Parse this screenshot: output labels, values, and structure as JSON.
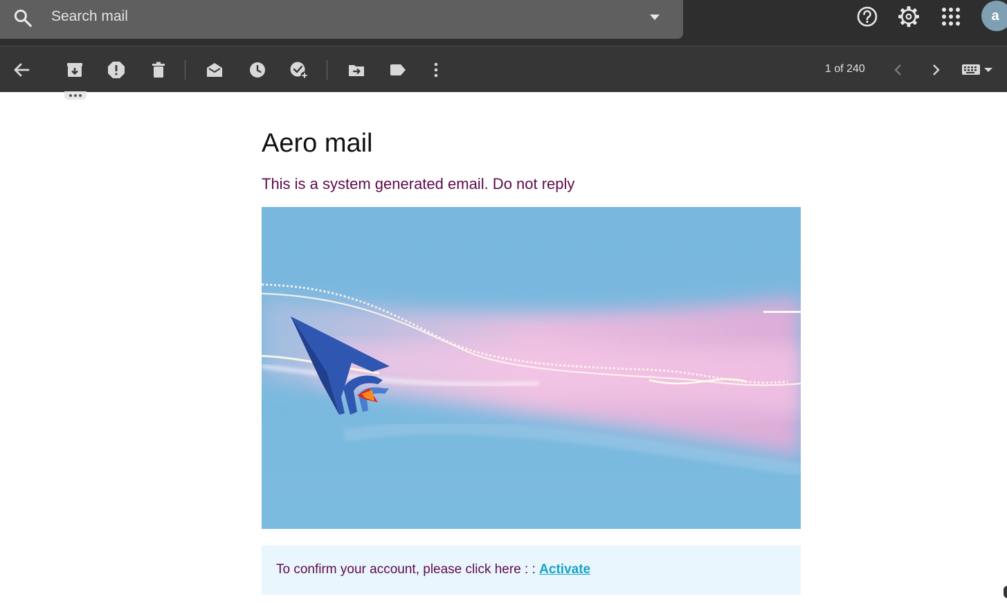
{
  "search": {
    "placeholder": "Search mail"
  },
  "header_icons": [
    "help-icon",
    "settings-gear-icon",
    "apps-grid-icon"
  ],
  "account": {
    "avatar_letter": "a",
    "color": "#7f9fb3"
  },
  "toolbar": {
    "actions": [
      "back-arrow-icon",
      "archive-icon",
      "report-spam-icon",
      "delete-icon",
      "mark-unread-icon",
      "snooze-icon",
      "add-to-tasks-icon",
      "move-to-icon",
      "label-icon",
      "more-vert-icon"
    ],
    "pager": "1 of 240"
  },
  "email": {
    "title": "Aero mail",
    "subtitle": "This is a system generated email. Do not reply",
    "confirm_text": "To confirm your account, please click here : : ",
    "activate_link": "Activate"
  },
  "colors": {
    "topbar": "#2e2e2e",
    "toolbar": "#363636",
    "subtitle_text": "#5e0a4a",
    "link": "#18a3c8",
    "confirm_bg": "#e9f6fd",
    "banner_sky": "#7ab8de"
  }
}
